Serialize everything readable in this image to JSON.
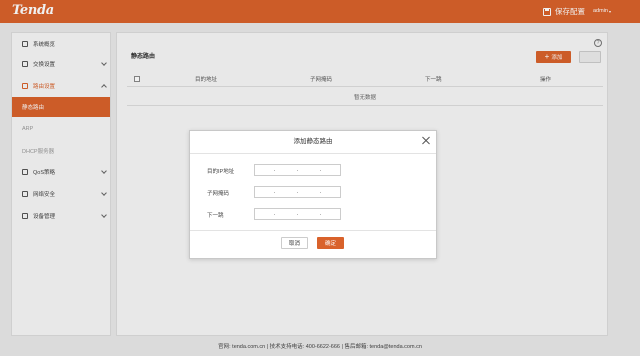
{
  "header": {
    "logo": "Tenda",
    "save_config": "保存配置",
    "user": "admin",
    "user_caret": "▾"
  },
  "sidebar": {
    "items": [
      {
        "label": "系统概览",
        "icon": "overview-icon"
      },
      {
        "label": "交换设置",
        "icon": "switch-icon"
      },
      {
        "label": "路由设置",
        "icon": "route-icon"
      },
      {
        "label": "QoS策略",
        "icon": "qos-icon"
      },
      {
        "label": "网络安全",
        "icon": "security-icon"
      },
      {
        "label": "设备管理",
        "icon": "device-icon"
      }
    ],
    "sub_items": [
      {
        "label": "静态路由"
      },
      {
        "label": "ARP"
      },
      {
        "label": "DHCP服务器"
      }
    ]
  },
  "panel": {
    "title": "静态路由",
    "add_label": "添加",
    "add_glyph": "+",
    "help_glyph": "?",
    "columns": [
      "目的地址",
      "子网掩码",
      "下一跳",
      "操作"
    ],
    "empty_text": "暂无数据"
  },
  "modal": {
    "title": "添加静态路由",
    "fields": [
      {
        "label": "目的IP地址"
      },
      {
        "label": "子网掩码"
      },
      {
        "label": "下一跳"
      }
    ],
    "ip_dot": ".",
    "cancel_label": "取消",
    "ok_label": "确定"
  },
  "footer": {
    "text": "官网: tenda.com.cn | 技术支持电话: 400-6622-666 | 售后邮箱: tenda@tenda.com.cn"
  },
  "colors": {
    "accent": "#d9622b",
    "background": "#e9e9e9",
    "panel": "#f7f7f7"
  }
}
